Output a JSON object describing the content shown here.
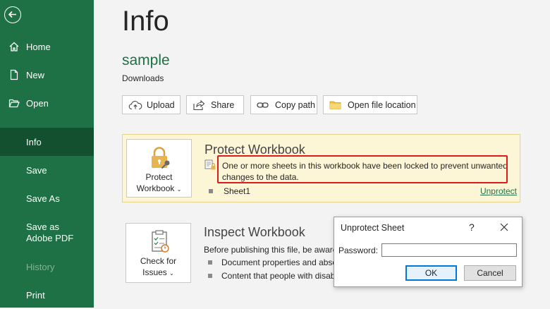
{
  "sidebar": {
    "items": [
      {
        "label": "Home",
        "icon": "home-icon"
      },
      {
        "label": "New",
        "icon": "new-document-icon"
      },
      {
        "label": "Open",
        "icon": "folder-open-icon"
      },
      {
        "label": "Info"
      },
      {
        "label": "Save"
      },
      {
        "label": "Save As"
      },
      {
        "label": "Save as Adobe PDF"
      },
      {
        "label": "History"
      },
      {
        "label": "Print"
      }
    ],
    "active": "Info",
    "disabled": "History"
  },
  "main": {
    "title": "Info",
    "doc_name": "sample",
    "doc_location": "Downloads",
    "toolbar": {
      "upload": "Upload",
      "share": "Share",
      "copy_path": "Copy path",
      "open_location": "Open file location"
    },
    "protect": {
      "button_line1": "Protect",
      "button_line2": "Workbook",
      "title": "Protect Workbook",
      "desc_line1": "One or more sheets in this workbook have been locked to prevent unwanted",
      "desc_line2": "changes to the data.",
      "sheet": "Sheet1",
      "unprotect": "Unprotect"
    },
    "inspect": {
      "button_line1": "Check for",
      "button_line2": "Issues",
      "title": "Inspect Workbook",
      "desc": "Before publishing this file, be aware",
      "bullet1": "Document properties and abso",
      "bullet2": "Content that people with disab"
    }
  },
  "dialog": {
    "title": "Unprotect Sheet",
    "help": "?",
    "password_label": "Password:",
    "password_value": "",
    "ok": "OK",
    "cancel": "Cancel"
  },
  "colors": {
    "sidebar": "#1e7145",
    "sidebar_active": "#13502f",
    "accent": "#1e7145",
    "highlight": "#e11b1b",
    "protect_bg": "#fdf6d6"
  }
}
